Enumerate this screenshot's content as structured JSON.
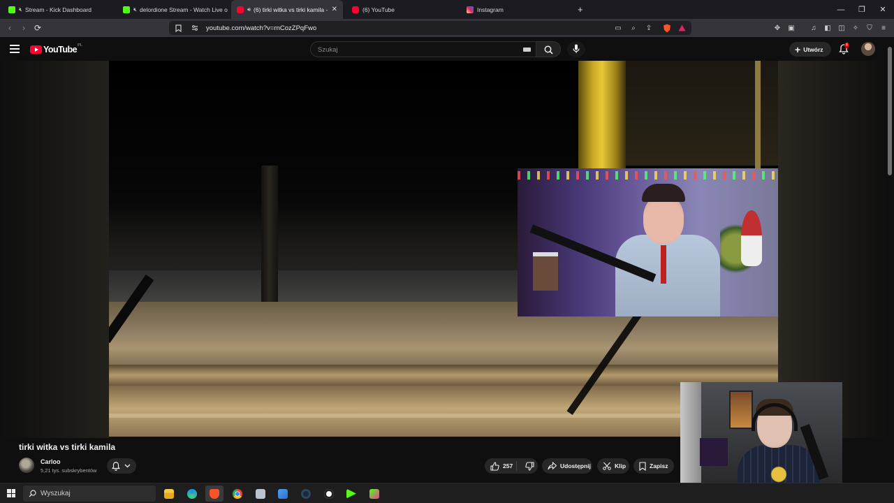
{
  "browser": {
    "tabs": [
      {
        "label": "Stream - Kick Dashboard",
        "favicon": "kick-icon",
        "color": "#53fc18",
        "muted": true,
        "active": false
      },
      {
        "label": "delordione Stream - Watch Live o",
        "favicon": "kick-icon",
        "color": "#53fc18",
        "muted": true,
        "active": false
      },
      {
        "label": "(6) tirki witka vs tirki kamila -",
        "favicon": "youtube-icon",
        "color": "#ff0033",
        "muted": true,
        "active": true
      },
      {
        "label": "(6) YouTube",
        "favicon": "youtube-icon",
        "color": "#ff0033",
        "muted": false,
        "active": false
      },
      {
        "label": "Instagram",
        "favicon": "instagram-icon",
        "color": "#e1306c",
        "muted": false,
        "active": false
      }
    ],
    "new_tab": "+",
    "url": "youtube.com/watch?v=rnCozZPqFwo"
  },
  "youtube": {
    "logo_text": "YouTube",
    "country_code": "PL",
    "search_placeholder": "Szukaj",
    "create_label": "Utwórz",
    "notification_count": "6",
    "video": {
      "title": "tirki witka vs tirki kamila",
      "channel": "Carloo",
      "subscribers": "5,21 tys. subskrybentów",
      "likes": "257",
      "share_label": "Udostępnij",
      "clip_label": "Klip",
      "save_label": "Zapisz"
    }
  },
  "taskbar": {
    "search_placeholder": "Wyszukaj",
    "apps": [
      "file-explorer-icon",
      "edge-icon",
      "brave-icon",
      "chrome-icon",
      "app-icon",
      "store-icon",
      "steam-icon",
      "game-icon",
      "kick-icon",
      "app2-icon"
    ]
  }
}
